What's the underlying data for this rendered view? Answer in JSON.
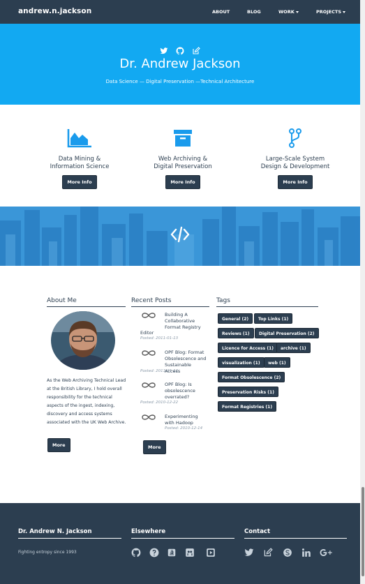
{
  "nav": {
    "brand": "andrew.n.jackson",
    "items": [
      {
        "label": "ABOUT",
        "dropdown": false
      },
      {
        "label": "BLOG",
        "dropdown": false
      },
      {
        "label": "WORK",
        "dropdown": true
      },
      {
        "label": "PROJECTS",
        "dropdown": true
      }
    ]
  },
  "hero": {
    "icons": [
      "twitter-icon",
      "github-icon",
      "edit-icon"
    ],
    "title": "Dr. Andrew Jackson",
    "subtitle": "Data Science — Digital Preservation —Technical Architecture"
  },
  "services": [
    {
      "icon": "area-chart-icon",
      "title_line1": "Data Mining &",
      "title_line2": "Information Science",
      "button": "More Info"
    },
    {
      "icon": "archive-box-icon",
      "title_line1": "Web Archiving &",
      "title_line2": "Digital Preservation",
      "button": "More Info"
    },
    {
      "icon": "code-fork-icon",
      "title_line1": "Large-Scale System",
      "title_line2": "Design & Development",
      "button": "More Info"
    }
  ],
  "about": {
    "heading": "About Me",
    "text": "As the Web Archiving Technical Lead at the British Library, I hold overall responsibility for the technical aspects of the ingest, indexing, discovery and access systems associated with the UK Web Archive.",
    "button": "More"
  },
  "posts": {
    "heading": "Recent Posts",
    "items": [
      {
        "title": "Building A Collaborative Format Registry",
        "title_overflow": "Editor",
        "date": "Posted: 2011-01-13"
      },
      {
        "title": "OPF Blog: Format Obsolescence and Sustainable Access",
        "title_overflow": "",
        "date": "Posted: 2011-01-12"
      },
      {
        "title": "OPF Blog: Is obsolescence overrated?",
        "title_overflow": "",
        "date": "Posted: 2010-12-22"
      },
      {
        "title": "Experimenting with Hadoop",
        "title_overflow": "",
        "date": "Posted: 2010-12-14"
      }
    ],
    "button": "More"
  },
  "tags": {
    "heading": "Tags",
    "items": [
      "General (2)",
      "Top Links (1)",
      "Reviews (1)",
      "Digital Preservation (2)",
      "Licence for Access (1)",
      "archive (1)",
      "visualization (1)",
      "web (1)",
      "Format Obsolescence (2)",
      "Preservation Risks (1)",
      "Format Registries (1)"
    ]
  },
  "footer": {
    "name_heading": "Dr. Andrew N. Jackson",
    "tagline": "Fighting entropy since 1993",
    "elsewhere_heading": "Elsewhere",
    "elsewhere_icons": [
      "github-icon",
      "stackoverflow-question-icon",
      "stackexchange-icon",
      "slideshare-icon",
      "youtube-play-icon"
    ],
    "contact_heading": "Contact",
    "contact_icons": [
      "twitter-icon",
      "edit-icon",
      "skype-icon",
      "linkedin-icon",
      "google-plus-icon"
    ]
  },
  "colors": {
    "navy": "#2c3e50",
    "hero_blue": "#12a9f2",
    "accent_blue": "#1a9bec"
  }
}
